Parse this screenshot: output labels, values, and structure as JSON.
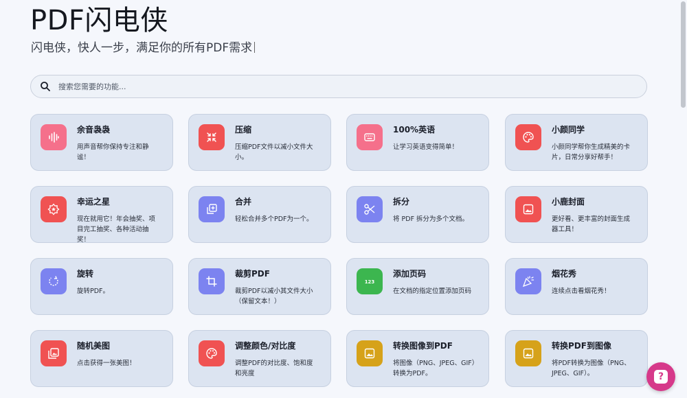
{
  "header": {
    "title": "PDF闪电侠",
    "subtitle": "闪电侠，快人一步，满足你的所有PDF需求"
  },
  "search": {
    "placeholder": "搜索您需要的功能...",
    "icon": "search-icon"
  },
  "cards": [
    {
      "title": "余音袅袅",
      "desc": "用声音帮你保持专注和静谧！",
      "icon": "audio-wave-icon",
      "color": "#f5708b"
    },
    {
      "title": "压缩",
      "desc": "压缩PDF文件以减小文件大小。",
      "icon": "compress-icon",
      "color": "#f05252"
    },
    {
      "title": "100%英语",
      "desc": "让学习英语变得简单！",
      "icon": "keyboard-icon",
      "color": "#f5708b"
    },
    {
      "title": "小颜同学",
      "desc": "小颜同学帮你生成精美的卡片，日常分享好帮手！",
      "icon": "palette-icon",
      "color": "#f05252"
    },
    {
      "title": "幸运之星",
      "desc": "现在就用它！年会抽奖、项目完工抽奖、各种活动抽奖！",
      "icon": "star-badge-icon",
      "color": "#f05252"
    },
    {
      "title": "合并",
      "desc": "轻松合并多个PDF为一个。",
      "icon": "merge-icon",
      "color": "#7c83f0"
    },
    {
      "title": "拆分",
      "desc": "将 PDF 拆分为多个文档。",
      "icon": "scissors-icon",
      "color": "#7c83f0"
    },
    {
      "title": "小鹿封面",
      "desc": "更好看、更丰富的封面生成器工具！",
      "icon": "image-icon",
      "color": "#f05252"
    },
    {
      "title": "旋转",
      "desc": "旋转PDF。",
      "icon": "rotate-icon",
      "color": "#7c83f0"
    },
    {
      "title": "裁剪PDF",
      "desc": "裁剪PDF以减小其文件大小（保留文本！）",
      "icon": "crop-icon",
      "color": "#7c83f0"
    },
    {
      "title": "添加页码",
      "desc": "在文档的指定位置添加页码",
      "icon": "page-number-icon",
      "color": "#3cb64f"
    },
    {
      "title": "烟花秀",
      "desc": "连续点击看烟花秀！",
      "icon": "party-popper-icon",
      "color": "#7c83f0"
    },
    {
      "title": "随机美图",
      "desc": "点击获得一张美图！",
      "icon": "photo-stack-icon",
      "color": "#f05252"
    },
    {
      "title": "调整颜色/对比度",
      "desc": "调整PDF的对比度、饱和度和亮度",
      "icon": "palette-icon",
      "color": "#f05252"
    },
    {
      "title": "转换图像到PDF",
      "desc": "将图像（PNG、JPEG、GIF）转换为PDF。",
      "icon": "image-icon",
      "color": "#d6a21a"
    },
    {
      "title": "转换PDF到图像",
      "desc": "将PDF转换为图像（PNG、JPEG、GIF）。",
      "icon": "image-icon",
      "color": "#d6a21a"
    }
  ],
  "help_button": {
    "label": "?",
    "icon": "help-icon",
    "color": "#d6398a"
  }
}
